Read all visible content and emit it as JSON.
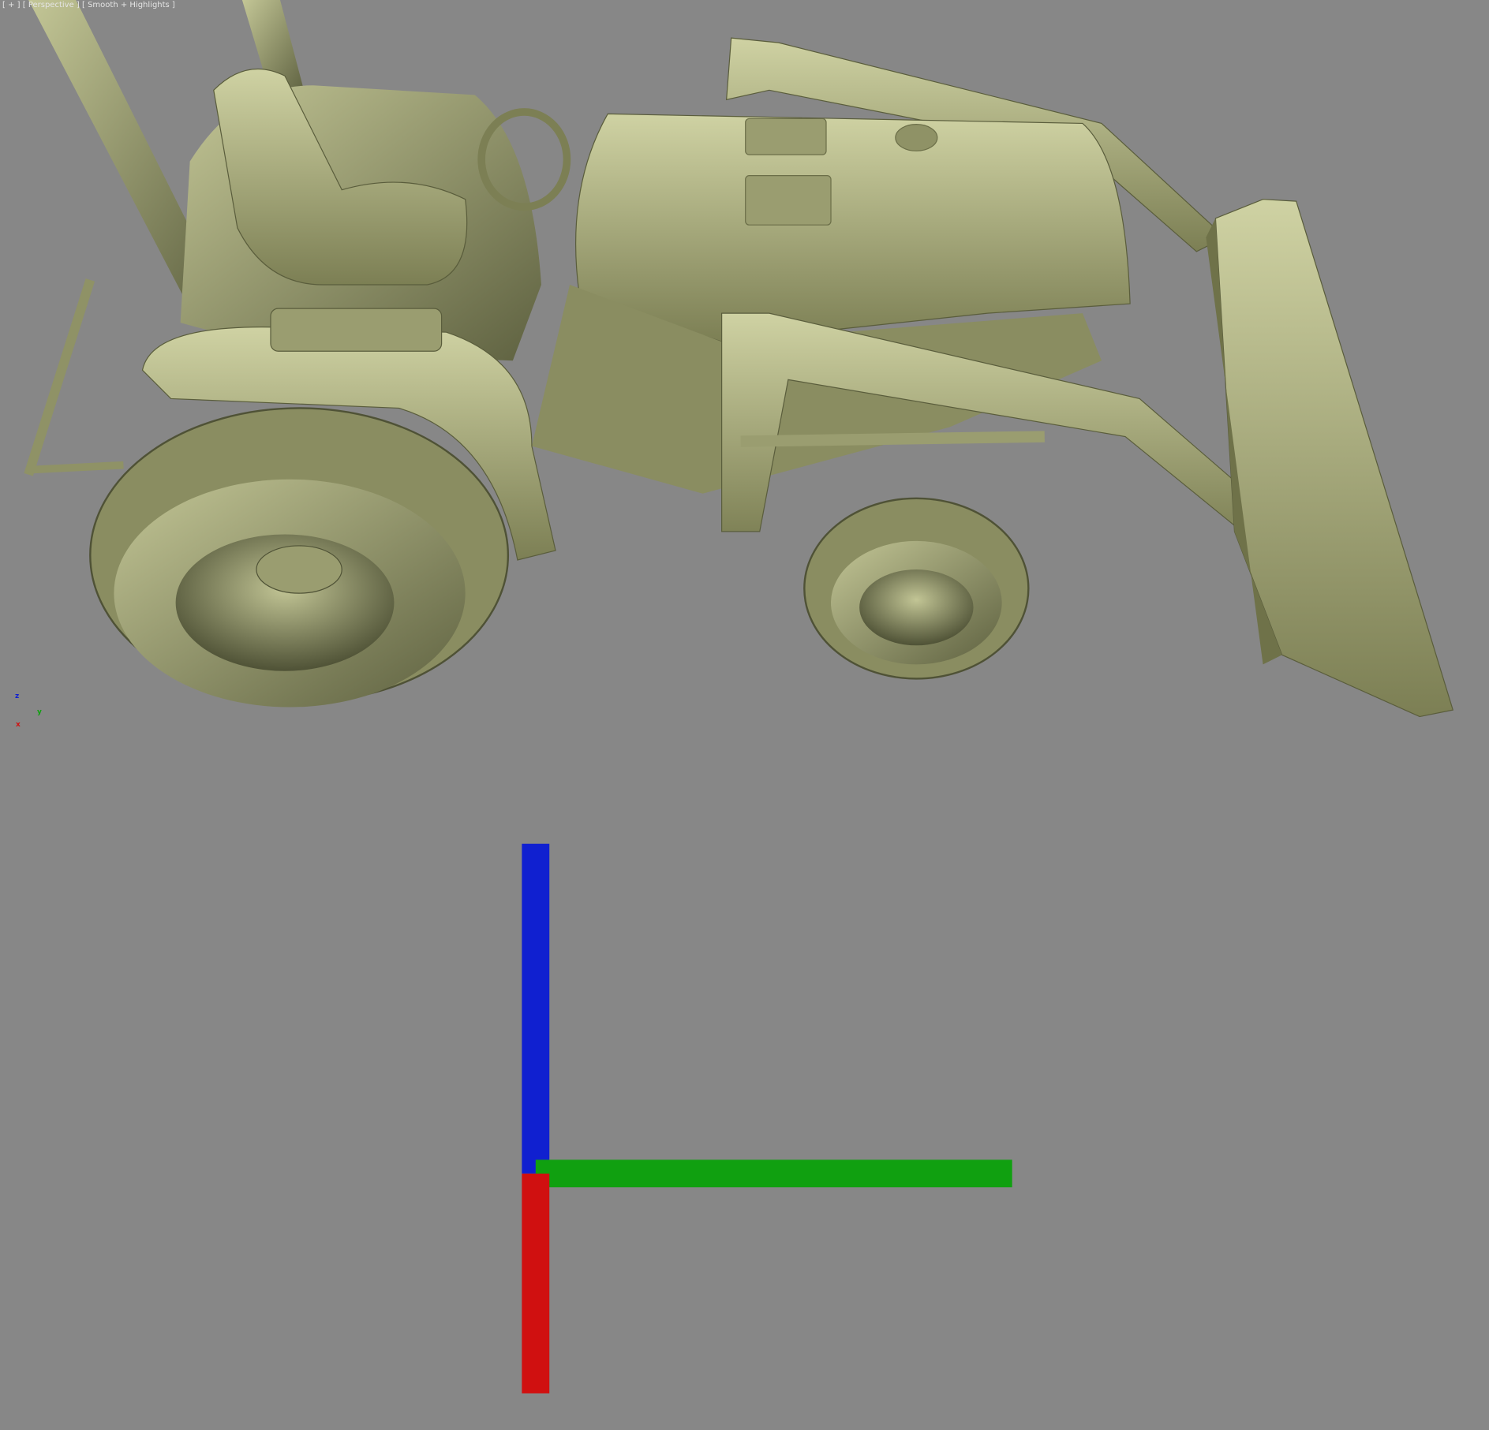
{
  "viewport": {
    "menu_label": "[ + ]",
    "view_label": "[ Perspective ]",
    "shading_label": "[ Smooth + Highlights ]",
    "background_color": "#878787",
    "model_color": "#b4b787"
  },
  "axis_gizmo": {
    "z_label": "z",
    "y_label": "y",
    "x_label": "x",
    "x_color": "#d01010",
    "y_color": "#10a010",
    "z_color": "#1020d0"
  }
}
